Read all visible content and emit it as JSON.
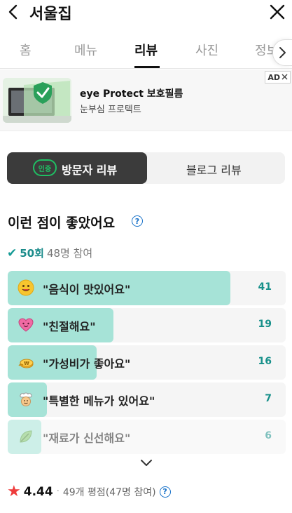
{
  "header": {
    "title": "서울집",
    "back_icon": "chevron-left-icon",
    "close_icon": "close-icon"
  },
  "tabs": [
    {
      "label": "홈",
      "active": false
    },
    {
      "label": "메뉴",
      "active": false
    },
    {
      "label": "리뷰",
      "active": true
    },
    {
      "label": "사진",
      "active": false
    },
    {
      "label": "정보",
      "active": false
    }
  ],
  "ad": {
    "title": "eye Protect 보호필름",
    "subtitle": "눈부심 프로텍트",
    "badge": "AD"
  },
  "review_toggle": {
    "visitor_badge": "인증",
    "visitor_label": "방문자 리뷰",
    "blog_label": "블로그 리뷰"
  },
  "liked": {
    "title": "이런 점이 좋았어요",
    "count": "50회",
    "participants": "48명 참여"
  },
  "review_items": [
    {
      "emoji": "smile-face-icon",
      "label": "\"음식이 맛있어요\"",
      "value": "41",
      "fill": 0.8
    },
    {
      "emoji": "heart-face-icon",
      "label": "\"친절해요\"",
      "value": "19",
      "fill": 0.38
    },
    {
      "emoji": "money-icon",
      "label": "\"가성비가 좋아요\"",
      "value": "16",
      "fill": 0.32
    },
    {
      "emoji": "chef-icon",
      "label": "\"특별한 메뉴가 있어요\"",
      "value": "7",
      "fill": 0.14
    },
    {
      "emoji": "leaf-icon",
      "label": "\"재료가 신선해요\"",
      "value": "6",
      "fill": 0.12
    }
  ],
  "rating": {
    "score": "4.44",
    "separator": "·",
    "summary": "49개 평점(47명 참여)"
  },
  "colors": {
    "bar_fill": "#a6e3d7",
    "bar_value": "#17908a",
    "star": "#ee3c3c",
    "accent_green": "#1fbf63",
    "help_blue": "#1a73c9"
  }
}
